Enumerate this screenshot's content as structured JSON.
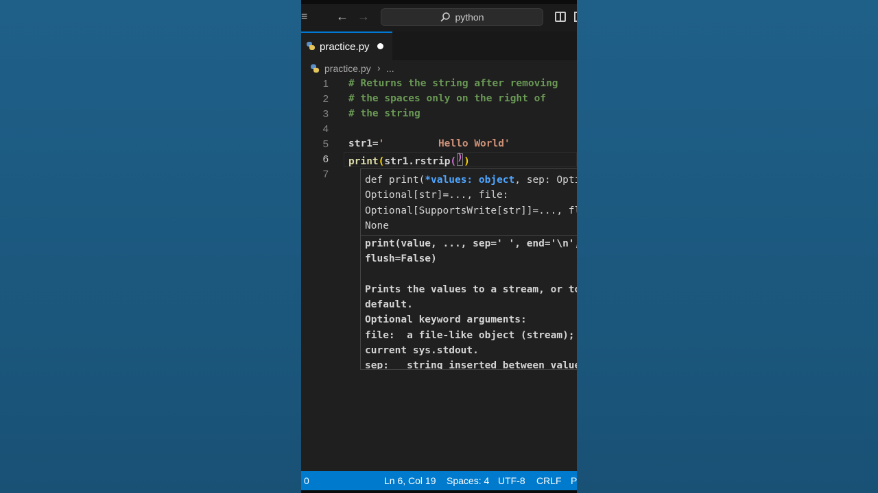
{
  "titlebar": {
    "search_text": "python",
    "icons": [
      "menu-icon",
      "back-arrow-icon",
      "forward-arrow-icon",
      "search-icon",
      "toggle-panel-icon"
    ]
  },
  "tab": {
    "filename": "practice.py",
    "unsaved": true
  },
  "breadcrumb": {
    "file": "practice.py",
    "separator": "›",
    "more": "..."
  },
  "editor": {
    "lines": [
      {
        "number": "1",
        "text": "# Returns the string after removing"
      },
      {
        "number": "2",
        "text": "# the spaces only on the right of"
      },
      {
        "number": "3",
        "text": "# the string"
      },
      {
        "number": "4",
        "text": ""
      },
      {
        "number": "5",
        "text": "str1='         Hello World'"
      },
      {
        "number": "6",
        "text": "print(str1.rstrip())"
      },
      {
        "number": "7",
        "text": ""
      }
    ],
    "active_line": "6",
    "line5": {
      "var": "str1=",
      "string": "'         Hello World'"
    },
    "line6": {
      "func": "print",
      "open": "(",
      "arg": "str1.rstrip",
      "close": ")"
    }
  },
  "hover": {
    "signature": {
      "l1_a": "def print(",
      "l1_param": "*values: object",
      "l1_b": ", sep: Optional[str]=...,",
      "l2": "Optional[str]=..., file:",
      "l3": "Optional[SupportsWrite[str]]=..., flush: bool=...) ->",
      "l4": "None"
    },
    "doc_lines": [
      "print(value, ..., sep=' ', end='\\n', file=sys.stdout,",
      "flush=False)",
      "",
      "Prints the values to a stream, or to sys.stdout by",
      "default.",
      "Optional keyword arguments:",
      "file:  a file-like object (stream); defaults to the",
      "current sys.stdout.",
      "sep:   string inserted between values, default a space."
    ]
  },
  "statusbar": {
    "problems": "0",
    "position": "Ln 6, Col 19",
    "spaces": "Spaces: 4",
    "encoding": "UTF-8",
    "eol": "CRLF",
    "language": "Python"
  },
  "colors": {
    "background": "#1e5a80",
    "editor_bg": "#1f1f1f",
    "statusbar": "#007acc",
    "comment": "#6a9955",
    "string": "#ce9178",
    "function": "#dcdcaa",
    "param_highlight": "#4fa5ff"
  }
}
